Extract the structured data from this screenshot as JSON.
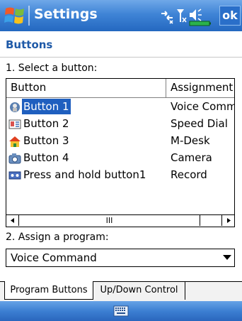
{
  "title_bar": {
    "app_title": "Settings",
    "ok_label": "ok",
    "status_icons": [
      "connectivity-icon",
      "signal-icon",
      "volume-icon",
      "battery-icon"
    ]
  },
  "page": {
    "heading": "Buttons",
    "heading_color": "#1f5aa8"
  },
  "step1_label": "1. Select a button:",
  "button_list": {
    "columns": [
      "Button",
      "Assignment"
    ],
    "rows": [
      {
        "icon": "voice-command-icon",
        "name": "Button 1",
        "assignment": "Voice Comm",
        "selected": true
      },
      {
        "icon": "speed-dial-icon",
        "name": "Button 2",
        "assignment": "Speed Dial",
        "selected": false
      },
      {
        "icon": "mdesk-house-icon",
        "name": "Button 3",
        "assignment": "M-Desk",
        "selected": false
      },
      {
        "icon": "camera-icon",
        "name": "Button 4",
        "assignment": "Camera",
        "selected": false
      },
      {
        "icon": "record-icon",
        "name": "Press and hold button1",
        "assignment": "Record",
        "selected": false
      }
    ],
    "scroll_thumb_glyph": "III"
  },
  "step2_label": "2. Assign a program:",
  "program_select": {
    "value": "Voice Command"
  },
  "tabs": [
    {
      "label": "Program Buttons",
      "active": true
    },
    {
      "label": "Up/Down Control",
      "active": false
    }
  ],
  "bottom_bar": {
    "input_icon": "keyboard-icon"
  },
  "colors": {
    "accent": "#3f84d6",
    "selection": "#1f5fbf"
  }
}
